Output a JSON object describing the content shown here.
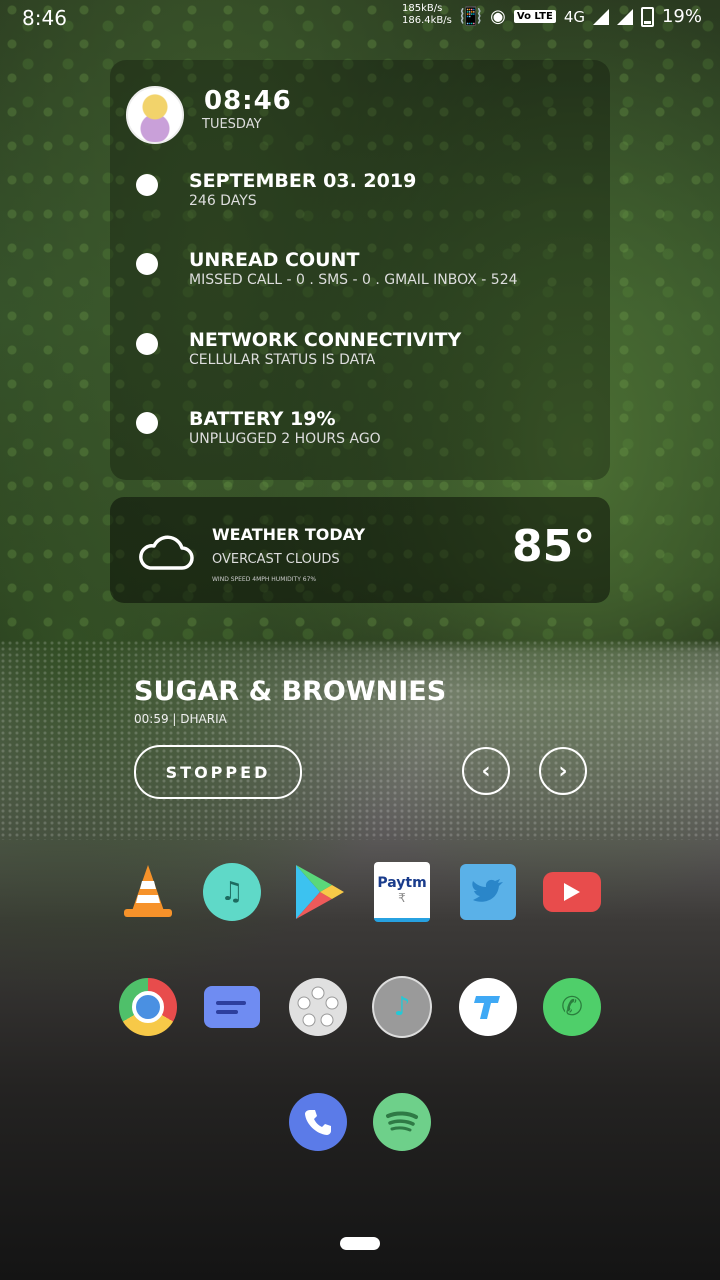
{
  "status_bar": {
    "time": "8:46",
    "net_up": "185kB/s",
    "net_down": "186.4kB/s",
    "volte": "Vo LTE",
    "network": "4G",
    "battery": "19%"
  },
  "widget": {
    "clock": "08:46",
    "day": "TUESDAY",
    "rows": [
      {
        "title": "SEPTEMBER 03. 2019",
        "subtitle": "246 DAYS"
      },
      {
        "title": "UNREAD COUNT",
        "subtitle": "MISSED CALL - 0  .  SMS - 0  .  GMAIL INBOX - 524"
      },
      {
        "title": "NETWORK CONNECTIVITY",
        "subtitle": "CELLULAR STATUS IS DATA"
      },
      {
        "title": "BATTERY 19%",
        "subtitle": "UNPLUGGED 2 HOURS AGO"
      }
    ]
  },
  "weather": {
    "title": "WEATHER TODAY",
    "condition": "OVERCAST CLOUDS",
    "details": "WIND SPEED 4MPH  HUMIDITY 67%",
    "temperature": "85°"
  },
  "music": {
    "song": "SUGAR & BROWNIES",
    "meta": "00:59 | DHARIA",
    "state_button": "STOPPED",
    "prev_symbol": "‹",
    "next_symbol": "›"
  },
  "apps": [
    {
      "name": "vlc-icon"
    },
    {
      "name": "music-icon"
    },
    {
      "name": "play-store-icon"
    },
    {
      "name": "paytm-icon",
      "label": "Paytm"
    },
    {
      "name": "twitter-icon"
    },
    {
      "name": "youtube-icon"
    },
    {
      "name": "chrome-icon"
    },
    {
      "name": "messages-icon"
    },
    {
      "name": "gallery-icon"
    },
    {
      "name": "music-player-icon"
    },
    {
      "name": "tez-icon"
    },
    {
      "name": "whatsapp-icon"
    },
    {
      "name": "phone-icon"
    },
    {
      "name": "spotify-icon"
    }
  ],
  "colors": {
    "music_teal": "#5fd9c8",
    "twitter_blue": "#5ab1e8",
    "youtube_red": "#e84c4c",
    "whatsapp_green": "#4fcf6a",
    "phone_blue": "#5b7be8",
    "spotify_green": "#6ed08a",
    "messages_blue": "#6f8cf2"
  }
}
